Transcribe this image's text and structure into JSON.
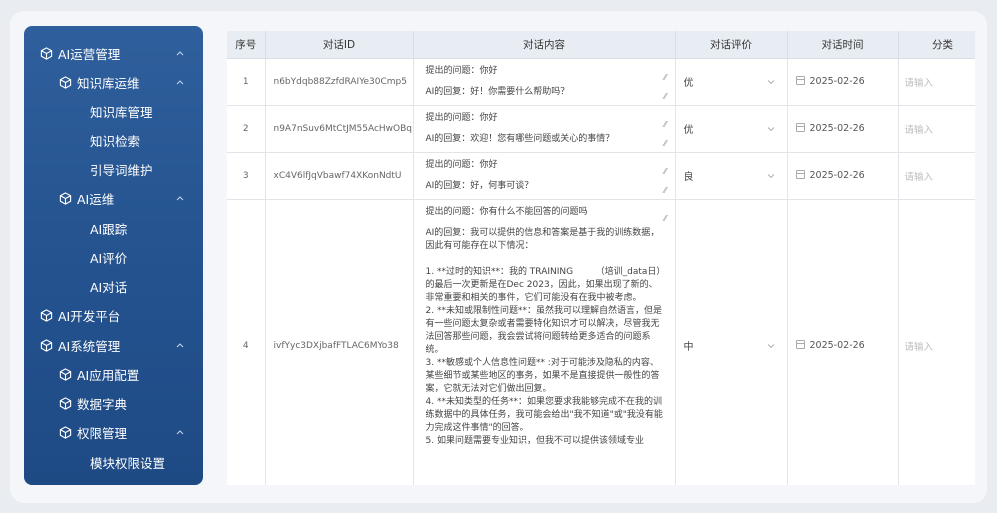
{
  "sidebar": {
    "items": [
      {
        "label": "AI运营管理",
        "icon": "cube-icon",
        "expanded": true
      },
      {
        "label": "知识库运维",
        "icon": "cube-icon",
        "expanded": true
      },
      {
        "label": "知识库管理"
      },
      {
        "label": "知识检索"
      },
      {
        "label": "引导词维护"
      },
      {
        "label": "AI运维",
        "icon": "cube-icon",
        "expanded": true
      },
      {
        "label": "AI跟踪"
      },
      {
        "label": "AI评价"
      },
      {
        "label": "AI对话"
      },
      {
        "label": "AI开发平台",
        "icon": "cube-icon"
      },
      {
        "label": "AI系统管理",
        "icon": "cube-icon",
        "expanded": true
      },
      {
        "label": "AI应用配置",
        "icon": "cube-icon"
      },
      {
        "label": "数据字典",
        "icon": "cube-icon"
      },
      {
        "label": "权限管理",
        "icon": "cube-icon",
        "expanded": true
      },
      {
        "label": "模块权限设置"
      }
    ]
  },
  "table": {
    "headers": [
      "序号",
      "对话ID",
      "对话内容",
      "对话评价",
      "对话时间",
      "分类"
    ],
    "category_placeholder": "请输入",
    "rows": [
      {
        "no": "1",
        "id": "n6bYdqb88ZzfdRAIYe30Cmp5",
        "question": "提出的问题：你好",
        "answer": "AI的回复：好！你需要什么帮助吗？",
        "rating": "优",
        "time": "2025-02-26"
      },
      {
        "no": "2",
        "id": "n9A7nSuv6MtCtJM55AcHwOBq",
        "question": "提出的问题：你好",
        "answer": "AI的回复：欢迎！您有哪些问题或关心的事情？",
        "rating": "优",
        "time": "2025-02-26"
      },
      {
        "no": "3",
        "id": "xC4V6lfJqVbawf74XKonNdtU",
        "question": "提出的问题：你好",
        "answer": "AI的回复：好，何事可谈？",
        "rating": "良",
        "time": "2025-02-26"
      },
      {
        "no": "4",
        "id": "ivfYyc3DXjbafFTLAC6MYo38",
        "question": "提出的问题：你有什么不能回答的问题吗",
        "answer": "AI的回复：我可以提供的信息和答案是基于我的训练数据，因此有可能存在以下情况：\n\n1. **过时的知识**：我的 TRAINING　　　（培训_data日）的最后一次更新是在Dec 2023，因此，如果出现了新的、非常重要和相关的事件，它们可能没有在我中被考虑。\n2. **未知或限制性问题**：虽然我可以理解自然语言，但是有一些问题太复杂或者需要特化知识才可以解决，尽管我无法回答那些问题，我会尝试将问题转给更多适合的问题系统。\n3. **敏感或个人信息性问题** :对于可能涉及隐私的内容、某些细节或某些地区的事务，如果不是直接提供一般性的答案，它就无法对它们做出回复。\n4. **未知类型的任务**：如果您要求我能够完成不在我的训练数据中的具体任务，我可能会给出\"我不知道\"或\"我没有能力完成这件事情\"的回答。\n5. 如果问题需要专业知识，但我不可以提供该领域专业",
        "rating": "中",
        "time": "2025-02-26"
      }
    ]
  }
}
